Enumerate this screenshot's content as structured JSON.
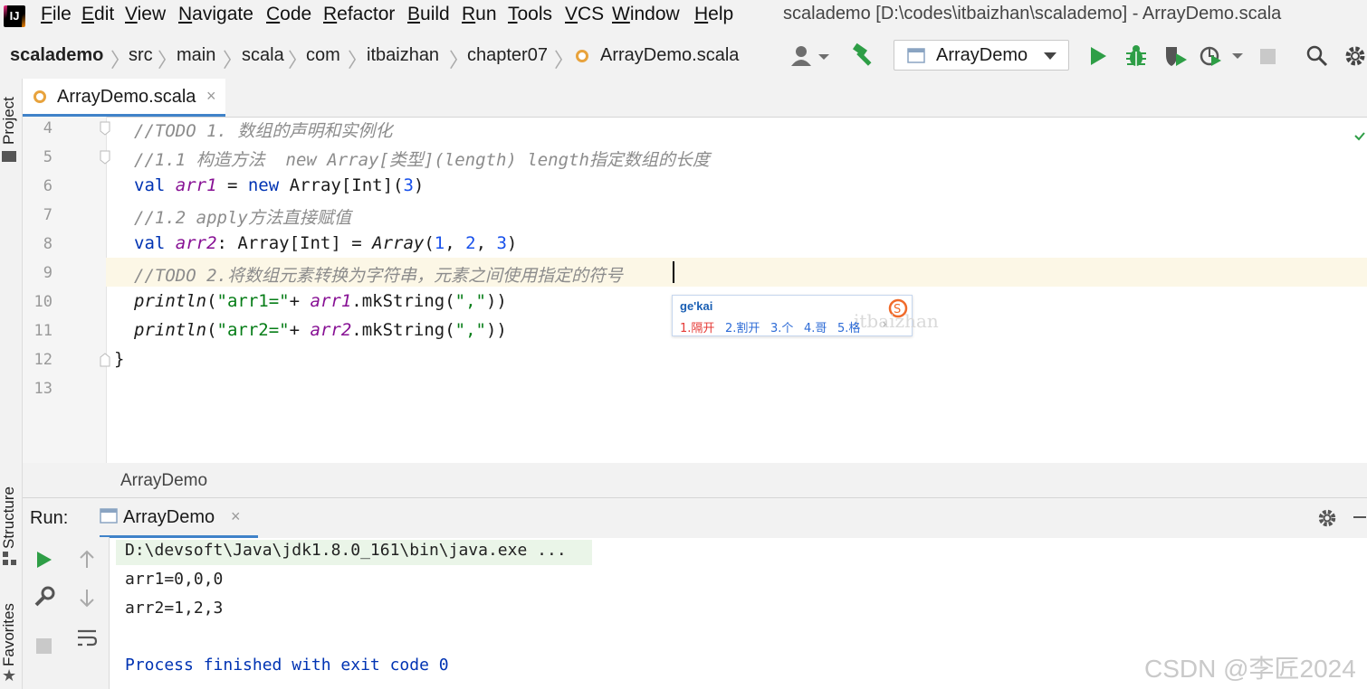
{
  "menu": {
    "items": [
      {
        "label": "File",
        "u": "F",
        "rest": "ile"
      },
      {
        "label": "Edit",
        "u": "E",
        "rest": "dit"
      },
      {
        "label": "View",
        "u": "V",
        "rest": "iew"
      },
      {
        "label": "Navigate",
        "u": "N",
        "rest": "avigate"
      },
      {
        "label": "Code",
        "u": "C",
        "rest": "ode"
      },
      {
        "label": "Refactor",
        "u": "R",
        "rest": "efactor"
      },
      {
        "label": "Build",
        "u": "B",
        "rest": "uild"
      },
      {
        "label": "Run",
        "u": "R",
        "rest": "un"
      },
      {
        "label": "Tools",
        "u": "T",
        "rest": "ools"
      },
      {
        "label": "VCS",
        "u": "V",
        "rest": "CS"
      },
      {
        "label": "Window",
        "u": "W",
        "rest": "indow"
      },
      {
        "label": "Help",
        "u": "H",
        "rest": "elp"
      }
    ],
    "window_title": "scalademo [D:\\codes\\itbaizhan\\scalademo] - ArrayDemo.scala"
  },
  "nav": {
    "crumbs": [
      "scalademo",
      "src",
      "main",
      "scala",
      "com",
      "itbaizhan",
      "chapter07",
      "ArrayDemo.scala"
    ],
    "run_config": "ArrayDemo"
  },
  "side": {
    "project": "Project",
    "structure": "Structure",
    "favorites": "Favorites"
  },
  "editor": {
    "tab_label": "ArrayDemo.scala",
    "line_numbers": [
      "4",
      "5",
      "6",
      "7",
      "8",
      "9",
      "10",
      "11",
      "12",
      "13"
    ],
    "lines": {
      "l4": "//TODO 1. 数组的声明和实例化",
      "l5": "//1.1 构造方法  new Array[类型](length) length指定数组的长度",
      "l6a": "val ",
      "l6b": "arr1",
      "l6c": " = ",
      "l6d": "new",
      "l6e": " Array[Int](",
      "l6f": "3",
      "l6g": ")",
      "l7": "//1.2 apply方法直接赋值",
      "l8a": "val ",
      "l8b": "arr2",
      "l8c": ": Array[Int] = ",
      "l8d": "Array",
      "l8e": "(",
      "l8f": "1",
      "l8g": ", ",
      "l8h": "2",
      "l8i": ", ",
      "l8j": "3",
      "l8k": ")",
      "l9": "//TODO 2.将数组元素转换为字符串，元素之间使用指定的符号",
      "l10a": "println",
      "l10b": "(",
      "l10c": "\"arr1=\"",
      "l10d": "+ ",
      "l10e": "arr1",
      "l10f": ".mkString(",
      "l10g": "\",\"",
      "l10h": "))",
      "l11a": "println",
      "l11b": "(",
      "l11c": "\"arr2=\"",
      "l11d": "+ ",
      "l11e": "arr2",
      "l11f": ".mkString(",
      "l11g": "\",\"",
      "l11h": "))",
      "l12": "}"
    },
    "breadcrumb": "ArrayDemo"
  },
  "ime": {
    "input": "ge'kai",
    "candidates": [
      "1.隔开",
      "2.割开",
      "3.个",
      "4.哥",
      "5.格"
    ],
    "watermark": "itbaizhan"
  },
  "run": {
    "label": "Run:",
    "tab_label": "ArrayDemo",
    "output": [
      "D:\\devsoft\\Java\\jdk1.8.0_161\\bin\\java.exe ...",
      "arr1=0,0,0",
      "arr2=1,2,3",
      "",
      "Process finished with exit code 0"
    ]
  },
  "watermark": "CSDN @李匠2024",
  "colors": {
    "accent": "#4083c9",
    "run_green": "#2e9e46",
    "comment": "#8c8c8c",
    "keyword": "#0033b3",
    "string": "#067d17",
    "number": "#1750eb",
    "var": "#871094"
  }
}
